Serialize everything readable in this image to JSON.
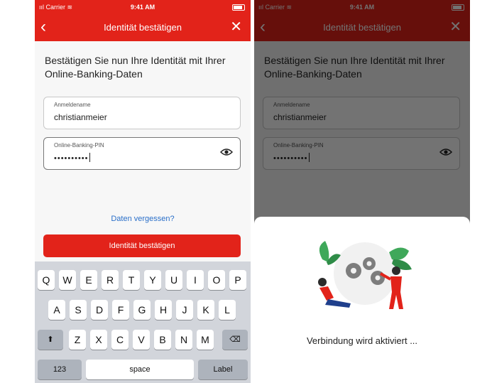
{
  "status_bar": {
    "carrier": "ııl Carrier ≋",
    "time": "9:41 AM"
  },
  "nav": {
    "title": "Identität bestätigen",
    "back_icon": "‹",
    "close_icon": "✕"
  },
  "heading": "Bestätigen Sie nun Ihre Identität mit Ihrer Online-Banking-Daten",
  "username_field": {
    "label": "Anmeldename",
    "value": "christianmeier"
  },
  "pin_field": {
    "label": "Online-Banking-PIN",
    "value": "••••••••••"
  },
  "forgot_link": "Daten vergessen?",
  "confirm_button": "Identität bestätigen",
  "keyboard": {
    "row1": [
      "Q",
      "W",
      "E",
      "R",
      "T",
      "Y",
      "U",
      "I",
      "O",
      "P"
    ],
    "row2": [
      "A",
      "S",
      "D",
      "F",
      "G",
      "H",
      "J",
      "K",
      "L"
    ],
    "row3": [
      "Z",
      "X",
      "C",
      "V",
      "B",
      "N",
      "M"
    ],
    "shift_icon": "⬆",
    "delete_icon": "⌫",
    "numbers": "123",
    "space": "space",
    "action": "Label"
  },
  "loading_text": "Verbindung wird aktiviert ..."
}
